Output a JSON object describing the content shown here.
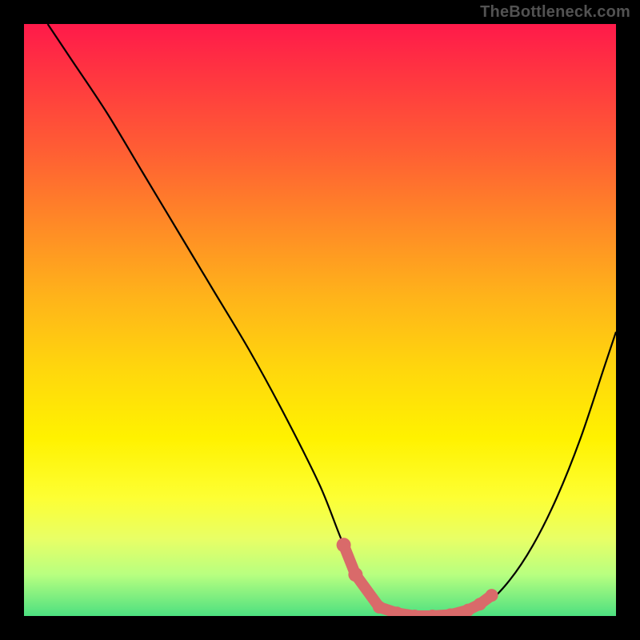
{
  "watermark": "TheBottleneck.com",
  "chart_data": {
    "type": "line",
    "title": "",
    "xlabel": "",
    "ylabel": "",
    "xlim": [
      0,
      100
    ],
    "ylim": [
      0,
      100
    ],
    "series": [
      {
        "name": "bottleneck-curve",
        "x": [
          4,
          8,
          14,
          20,
          26,
          32,
          38,
          44,
          50,
          54,
          58,
          62,
          66,
          70,
          74,
          78,
          82,
          86,
          90,
          94,
          98,
          100
        ],
        "y": [
          100,
          94,
          85,
          75,
          65,
          55,
          45,
          34,
          22,
          12,
          4,
          0.5,
          0,
          0,
          0.5,
          2,
          6,
          12,
          20,
          30,
          42,
          48
        ]
      }
    ],
    "markers": {
      "name": "highlight-dots",
      "color": "#d96a6a",
      "points": [
        {
          "x": 54,
          "y": 12
        },
        {
          "x": 56,
          "y": 7
        },
        {
          "x": 60,
          "y": 1.5
        },
        {
          "x": 63,
          "y": 0.5
        },
        {
          "x": 66,
          "y": 0
        },
        {
          "x": 69,
          "y": 0
        },
        {
          "x": 72,
          "y": 0.2
        },
        {
          "x": 75,
          "y": 1
        },
        {
          "x": 77,
          "y": 2
        },
        {
          "x": 79,
          "y": 3.5
        }
      ]
    }
  }
}
